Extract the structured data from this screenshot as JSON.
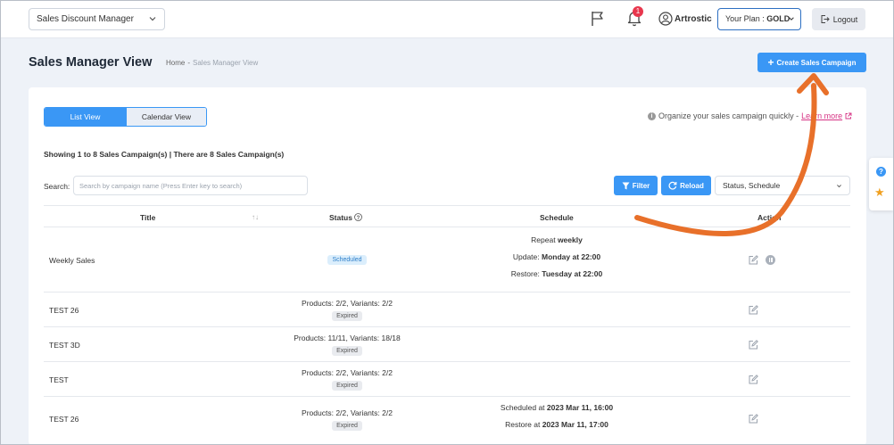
{
  "header": {
    "app_select": "Sales Discount Manager",
    "notification_count": "1",
    "user_name": "Artrostic",
    "plan_label": "Your Plan : ",
    "plan_value": "GOLD",
    "logout": "Logout"
  },
  "page": {
    "title": "Sales Manager View",
    "breadcrumb_home": "Home",
    "breadcrumb_sep": "-",
    "breadcrumb_current": "Sales Manager View",
    "create_button": "Create Sales Campaign"
  },
  "toolbar": {
    "list_view": "List View",
    "calendar_view": "Calendar View",
    "info_text": "Organize your sales campaign quickly -",
    "learn_more": "Learn more",
    "showing": "Showing 1 to 8 Sales Campaign(s) | There are 8 Sales Campaign(s)",
    "search_label": "Search:",
    "search_placeholder": "Search by campaign name (Press Enter key to search)",
    "filter": "Filter",
    "reload": "Reload",
    "sort_value": "Status, Schedule"
  },
  "table": {
    "headers": {
      "title": "Title",
      "status": "Status",
      "schedule": "Schedule",
      "action": "Action"
    },
    "rows": [
      {
        "title": "Weekly Sales",
        "badge": "Scheduled",
        "sched_repeat_label": "Repeat ",
        "sched_repeat_value": "weekly",
        "sched_update_label": "Update: ",
        "sched_update_value": "Monday at 22:00",
        "sched_restore_label": "Restore: ",
        "sched_restore_value": "Tuesday at 22:00"
      },
      {
        "title": "TEST 26",
        "products": "Products: 2/2, Variants: 2/2",
        "badge": "Expired"
      },
      {
        "title": "TEST 3D",
        "products": "Products: 11/11, Variants: 18/18",
        "badge": "Expired"
      },
      {
        "title": "TEST",
        "products": "Products: 2/2, Variants: 2/2",
        "badge": "Expired"
      },
      {
        "title": "TEST 26",
        "products": "Products: 2/2, Variants: 2/2",
        "badge": "Expired",
        "sched_start_label": "Scheduled at ",
        "sched_start_value": "2023 Mar 11, 16:00",
        "sched_restore_label": "Restore at ",
        "sched_restore_value": "2023 Mar 11, 17:00"
      }
    ]
  },
  "colors": {
    "primary": "#3a97f5",
    "arrow": "#e8702a",
    "badge_red": "#e8374d"
  }
}
